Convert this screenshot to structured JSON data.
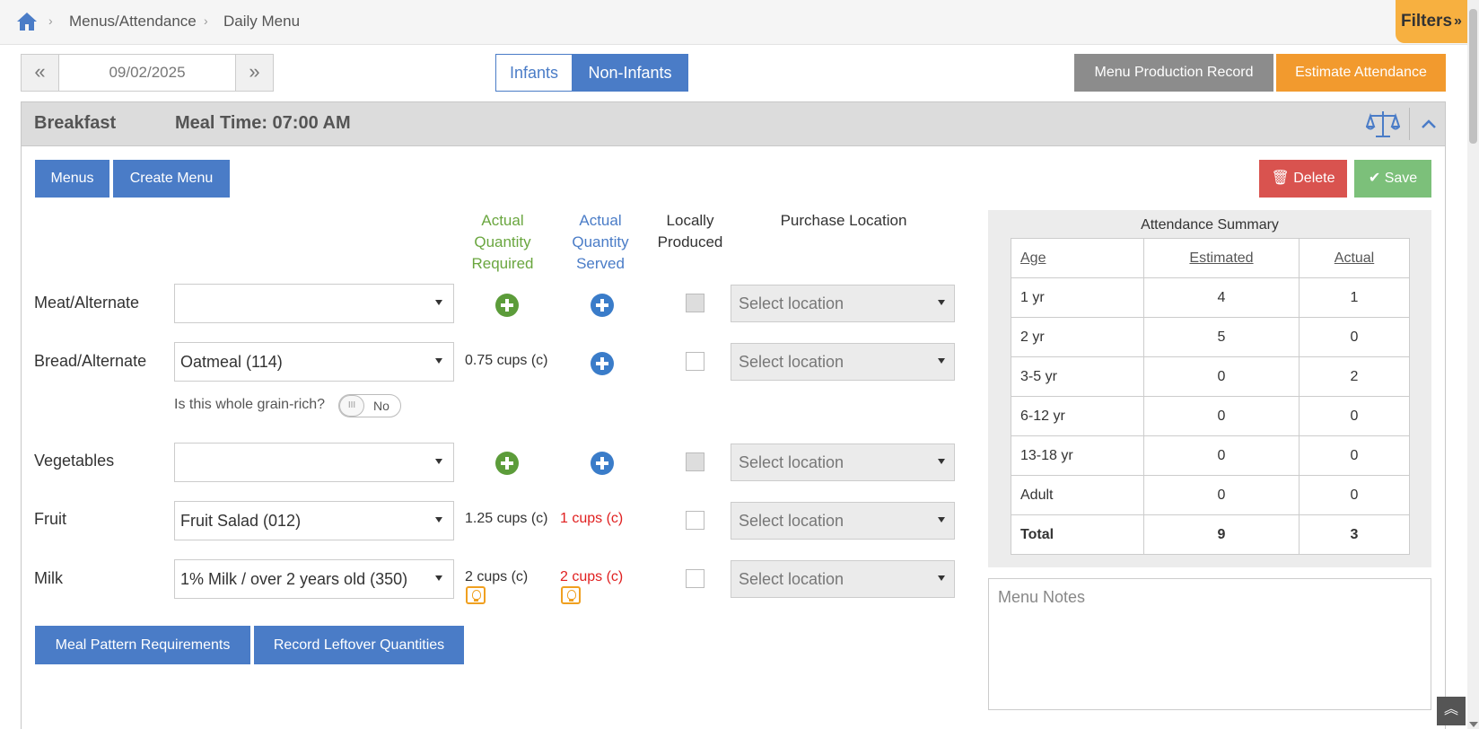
{
  "breadcrumb": {
    "items": [
      "Menus/Attendance",
      "Daily Menu"
    ]
  },
  "filters": {
    "label": "Filters"
  },
  "date": {
    "value": "09/02/2025",
    "prev": "«",
    "next": "»"
  },
  "infant_toggle": {
    "infants": "Infants",
    "non_infants": "Non-Infants",
    "selected": "Non-Infants"
  },
  "header_buttons": {
    "menu_production_record": "Menu Production Record",
    "estimate_attendance": "Estimate Attendance"
  },
  "meal": {
    "name": "Breakfast",
    "time": "Meal Time: 07:00 AM"
  },
  "actions": {
    "menus": "Menus",
    "create_menu": "Create Menu",
    "delete": "Delete",
    "save": "Save"
  },
  "columns": {
    "actual_required": "Actual Quantity Required",
    "actual_served": "Actual Quantity Served",
    "locally_produced": "Locally Produced",
    "purchase_location": "Purchase Location"
  },
  "components": [
    {
      "label": "Meat/Alternate",
      "item": "",
      "required": "",
      "served": "",
      "local_disabled": true,
      "location": "Select location"
    },
    {
      "label": "Bread/Alternate",
      "item": "Oatmeal (114)",
      "required": "0.75 cups (c)",
      "served": "",
      "local_disabled": false,
      "location": "Select location"
    },
    {
      "label": "Vegetables",
      "item": "",
      "required": "",
      "served": "",
      "local_disabled": true,
      "location": "Select location"
    },
    {
      "label": "Fruit",
      "item": "Fruit Salad (012)",
      "required": "1.25 cups (c)",
      "served": "1 cups (c)",
      "local_disabled": false,
      "location": "Select location"
    },
    {
      "label": "Milk",
      "item": "1% Milk / over 2 years old (350)",
      "required": "2 cups (c)",
      "served": "2 cups (c)",
      "local_disabled": false,
      "location": "Select location"
    }
  ],
  "whole_grain": {
    "question": "Is this whole grain-rich?",
    "toggle_value": "No",
    "knob": "III"
  },
  "bottom_buttons": {
    "meal_pattern": "Meal Pattern Requirements",
    "record_leftover": "Record Leftover Quantities"
  },
  "attendance": {
    "title": "Attendance Summary",
    "headers": [
      "Age",
      "Estimated",
      "Actual"
    ],
    "rows": [
      [
        "1 yr",
        "4",
        "1"
      ],
      [
        "2 yr",
        "5",
        "0"
      ],
      [
        "3-5 yr",
        "0",
        "2"
      ],
      [
        "6-12 yr",
        "0",
        "0"
      ],
      [
        "13-18 yr",
        "0",
        "0"
      ],
      [
        "Adult",
        "0",
        "0"
      ],
      [
        "Total",
        "9",
        "3"
      ]
    ]
  },
  "notes": {
    "placeholder": "Menu Notes"
  },
  "colors": {
    "primary": "#4a7cc7",
    "orange": "#f29a2e",
    "danger": "#d9534f",
    "success": "#7cc07a",
    "required_text": "#6aa63f",
    "warning_text": "#e02020"
  }
}
